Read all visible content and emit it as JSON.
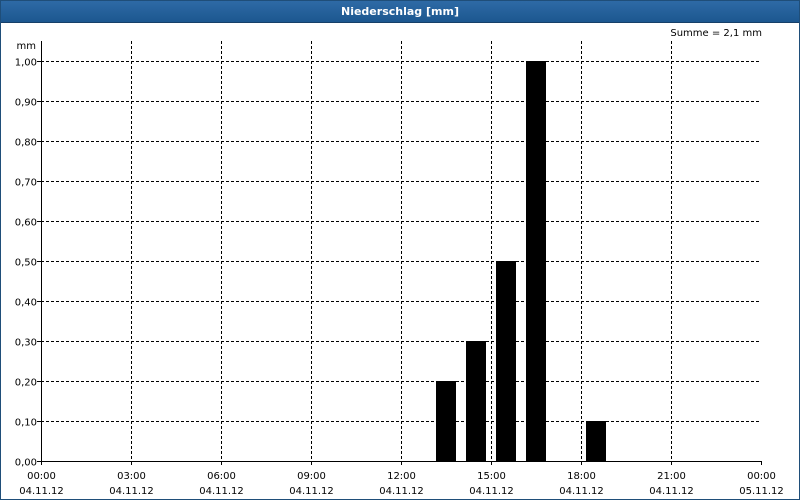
{
  "chart_data": {
    "type": "bar",
    "title": "Niederschlag [mm]",
    "ylabel": "mm",
    "summary": "Summe = 2,1 mm",
    "ylim": [
      0,
      1.0
    ],
    "yticks": [
      "0,00",
      "0,10",
      "0,20",
      "0,30",
      "0,40",
      "0,50",
      "0,60",
      "0,70",
      "0,80",
      "0,90",
      "1,00"
    ],
    "xrange_hours": [
      0,
      24
    ],
    "xticks": [
      {
        "hour": 0,
        "time": "00:00",
        "date": "04.11.12"
      },
      {
        "hour": 3,
        "time": "03:00",
        "date": "04.11.12"
      },
      {
        "hour": 6,
        "time": "06:00",
        "date": "04.11.12"
      },
      {
        "hour": 9,
        "time": "09:00",
        "date": "04.11.12"
      },
      {
        "hour": 12,
        "time": "12:00",
        "date": "04.11.12"
      },
      {
        "hour": 15,
        "time": "15:00",
        "date": "04.11.12"
      },
      {
        "hour": 18,
        "time": "18:00",
        "date": "04.11.12"
      },
      {
        "hour": 21,
        "time": "21:00",
        "date": "04.11.12"
      },
      {
        "hour": 24,
        "time": "00:00",
        "date": "05.11.12"
      }
    ],
    "bars": [
      {
        "hour": 14,
        "value": 0.2
      },
      {
        "hour": 15,
        "value": 0.3
      },
      {
        "hour": 16,
        "value": 0.5
      },
      {
        "hour": 17,
        "value": 1.0
      },
      {
        "hour": 19,
        "value": 0.1
      }
    ],
    "grid": true,
    "bar_color": "#000000"
  }
}
